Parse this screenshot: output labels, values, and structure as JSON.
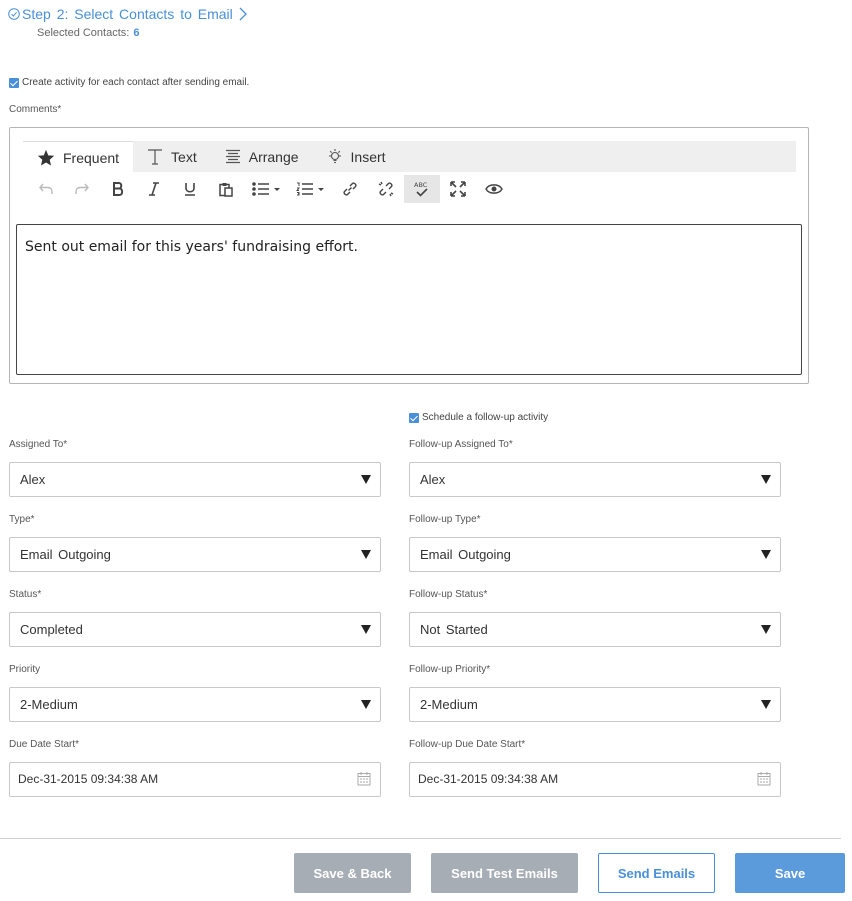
{
  "step": {
    "title": "Step 2: Select Contacts to Email",
    "selected_label": "Selected Contacts:",
    "selected_count": "6"
  },
  "create_activity": {
    "label": "Create activity for each contact after sending email.",
    "checked": true
  },
  "comments": {
    "label": "Comments*",
    "tabs": [
      {
        "label": "Frequent",
        "icon": "star-icon"
      },
      {
        "label": "Text",
        "icon": "text-icon"
      },
      {
        "label": "Arrange",
        "icon": "align-icon"
      },
      {
        "label": "Insert",
        "icon": "bulb-icon"
      }
    ],
    "body_text": "Sent out email for this years' fundraising effort."
  },
  "follow_up_toggle": {
    "label": "Schedule a follow-up activity",
    "checked": true
  },
  "left_fields": {
    "assigned_to": {
      "label": "Assigned To*",
      "value": "Alex"
    },
    "type": {
      "label": "Type*",
      "value": "Email  Outgoing"
    },
    "status": {
      "label": "Status*",
      "value": "Completed"
    },
    "priority": {
      "label": "Priority",
      "value": "2-Medium"
    },
    "due_date": {
      "label": "Due Date Start*",
      "value": "Dec-31-2015 09:34:38 AM"
    }
  },
  "right_fields": {
    "assigned_to": {
      "label": "Follow-up Assigned To*",
      "value": "Alex"
    },
    "type": {
      "label": "Follow-up Type*",
      "value": "Email  Outgoing"
    },
    "status": {
      "label": "Follow-up Status*",
      "value": "Not  Started"
    },
    "priority": {
      "label": "Follow-up Priority*",
      "value": "2-Medium"
    },
    "due_date": {
      "label": "Follow-up Due Date Start*",
      "value": "Dec-31-2015 09:34:38 AM"
    }
  },
  "buttons": {
    "save_back": "Save & Back",
    "send_test": "Send Test Emails",
    "send": "Send Emails",
    "save": "Save"
  },
  "colors": {
    "accent": "#4a90d9",
    "gray_button": "#a6adb4",
    "primary_button": "#5b9bdc"
  }
}
